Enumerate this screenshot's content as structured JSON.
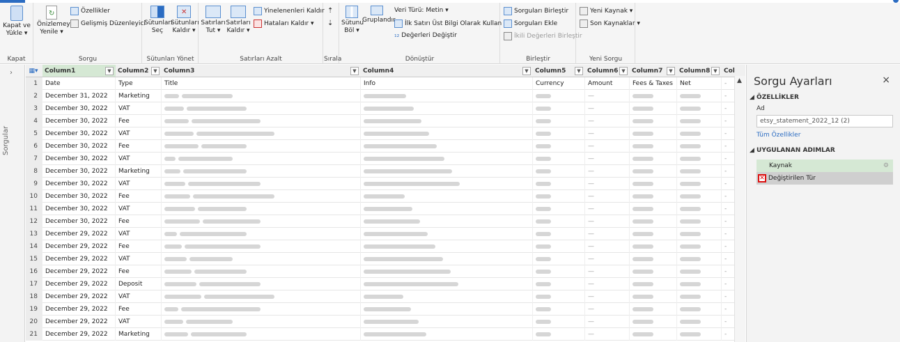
{
  "ribbon": {
    "groups": {
      "kapat": {
        "label": "Kapat",
        "btn": "Kapat ve\nYükle ▾"
      },
      "sorgu": {
        "label": "Sorgu",
        "refresh": "Önizlemeyi\nYenile ▾",
        "props": "Özellikler",
        "adv": "Gelişmiş Düzenleyici"
      },
      "sutunlar": {
        "label": "Sütunları Yönet",
        "select": "Sütunları\nSeç",
        "remove": "Sütunları\nKaldır ▾"
      },
      "satirlar": {
        "label": "Satırları Azalt",
        "keep": "Satırları\nTut ▾",
        "remove": "Satırları\nKaldır ▾",
        "dups": "Yinelenenleri Kaldır",
        "errors": "Hataları Kaldır ▾"
      },
      "sirala": {
        "label": "Sırala"
      },
      "donustur": {
        "label": "Dönüştür",
        "split": "Sütunu\nBöl ▾",
        "group": "Gruplandır",
        "dtype": "Veri Türü: Metin ▾",
        "header": "İlk Satırı Üst Bilgi Olarak Kullan ▾",
        "replace": "Değerleri Değiştir"
      },
      "birlestir": {
        "label": "Birleştir",
        "merge": "Sorguları Birleştir",
        "append": "Sorguları Ekle",
        "binary": "İkili Değerleri Birleştir"
      },
      "yeni": {
        "label": "Yeni Sorgu",
        "new": "Yeni Kaynak ▾",
        "recent": "Son Kaynaklar ▾"
      }
    }
  },
  "left_pane": {
    "label": "Sorgular",
    "chevron": "›"
  },
  "grid": {
    "columns": [
      "Column1",
      "Column2",
      "Column3",
      "Column4",
      "Column5",
      "Column6",
      "Column7",
      "Column8",
      "Col"
    ],
    "rows": [
      [
        "1",
        "Date",
        "Type",
        "Title",
        "Info",
        "Currency",
        "Amount",
        "Fees & Taxes",
        "Net"
      ],
      [
        "2",
        "December 31, 2022",
        "Marketing",
        "",
        "",
        "",
        "",
        "",
        ""
      ],
      [
        "3",
        "December 30, 2022",
        "VAT",
        "",
        "",
        "",
        "",
        "",
        ""
      ],
      [
        "4",
        "December 30, 2022",
        "Fee",
        "",
        "",
        "",
        "",
        "",
        ""
      ],
      [
        "5",
        "December 30, 2022",
        "VAT",
        "",
        "",
        "",
        "",
        "",
        ""
      ],
      [
        "6",
        "December 30, 2022",
        "Fee",
        "",
        "",
        "",
        "",
        "",
        ""
      ],
      [
        "7",
        "December 30, 2022",
        "VAT",
        "",
        "",
        "",
        "",
        "",
        ""
      ],
      [
        "8",
        "December 30, 2022",
        "Marketing",
        "",
        "",
        "",
        "",
        "",
        ""
      ],
      [
        "9",
        "December 30, 2022",
        "VAT",
        "",
        "",
        "",
        "",
        "",
        ""
      ],
      [
        "10",
        "December 30, 2022",
        "Fee",
        "",
        "",
        "",
        "",
        "",
        ""
      ],
      [
        "11",
        "December 30, 2022",
        "VAT",
        "",
        "",
        "",
        "",
        "",
        ""
      ],
      [
        "12",
        "December 30, 2022",
        "Fee",
        "",
        "",
        "",
        "",
        "",
        ""
      ],
      [
        "13",
        "December 29, 2022",
        "VAT",
        "",
        "",
        "",
        "",
        "",
        ""
      ],
      [
        "14",
        "December 29, 2022",
        "Fee",
        "",
        "",
        "",
        "",
        "",
        ""
      ],
      [
        "15",
        "December 29, 2022",
        "VAT",
        "",
        "",
        "",
        "",
        "",
        ""
      ],
      [
        "16",
        "December 29, 2022",
        "Fee",
        "",
        "",
        "",
        "",
        "",
        ""
      ],
      [
        "17",
        "December 29, 2022",
        "Deposit",
        "",
        "",
        "",
        "",
        "",
        ""
      ],
      [
        "18",
        "December 29, 2022",
        "VAT",
        "",
        "",
        "",
        "",
        "",
        ""
      ],
      [
        "19",
        "December 29, 2022",
        "Fee",
        "",
        "",
        "",
        "",
        "",
        ""
      ],
      [
        "20",
        "December 29, 2022",
        "VAT",
        "",
        "",
        "",
        "",
        "",
        ""
      ],
      [
        "21",
        "December 29, 2022",
        "Marketing",
        "",
        "",
        "",
        "",
        "",
        ""
      ]
    ]
  },
  "settings": {
    "title": "Sorgu Ayarları",
    "close": "×",
    "props_header": "◢ ÖZELLİKLER",
    "name_label": "Ad",
    "name_value": "etsy_statement_2022_12 (2)",
    "all_props": "Tüm Özellikler",
    "steps_header": "◢ UYGULANAN ADIMLAR",
    "steps": [
      "Kaynak",
      "Değiştirilen Tür"
    ],
    "gear": "⚙",
    "x": "✕"
  }
}
